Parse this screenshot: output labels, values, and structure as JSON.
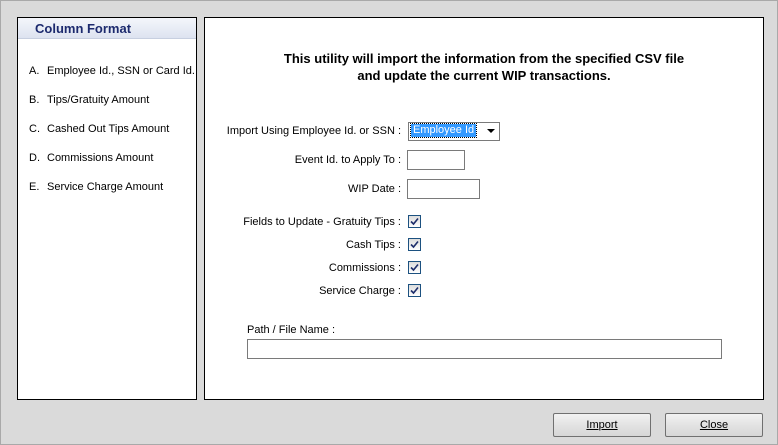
{
  "column_format": {
    "title": "Column Format",
    "items": [
      {
        "letter": "A.",
        "label": "Employee Id., SSN or Card Id."
      },
      {
        "letter": "B.",
        "label": "Tips/Gratuity Amount"
      },
      {
        "letter": "C.",
        "label": "Cashed Out Tips Amount"
      },
      {
        "letter": "D.",
        "label": "Commissions Amount"
      },
      {
        "letter": "E.",
        "label": "Service Charge Amount"
      }
    ]
  },
  "main": {
    "headline_line1": "This utility will import the information from the specified CSV file",
    "headline_line2": "and update the current WIP transactions.",
    "import_using_label": "Import Using Employee Id. or SSN :",
    "import_using_value": "Employee Id",
    "event_id_label": "Event Id. to Apply To :",
    "event_id_value": "",
    "wip_date_label": "WIP Date :",
    "wip_date_value": "",
    "fields": [
      {
        "label": "Fields to Update - Gratuity Tips :",
        "checked": true
      },
      {
        "label": "Cash Tips :",
        "checked": true
      },
      {
        "label": "Commissions :",
        "checked": true
      },
      {
        "label": "Service Charge :",
        "checked": true
      }
    ],
    "path_label": "Path / File Name :",
    "path_value": ""
  },
  "buttons": {
    "import_label": "Import",
    "close_label": "Close"
  }
}
